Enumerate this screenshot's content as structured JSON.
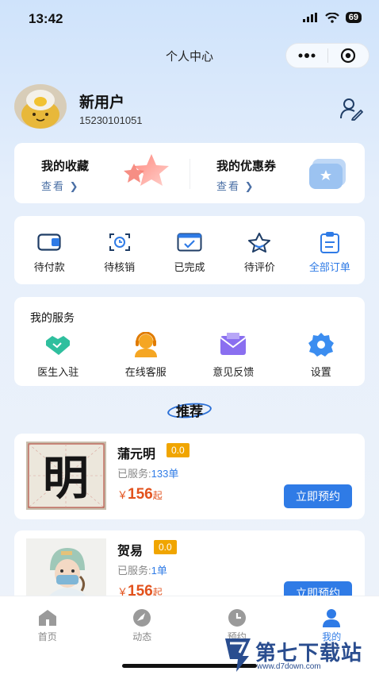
{
  "status_bar": {
    "time": "13:42",
    "battery": "69"
  },
  "nav": {
    "title": "个人中心"
  },
  "profile": {
    "name": "新用户",
    "phone": "15230101051"
  },
  "favorites": {
    "my_favorites": {
      "title": "我的收藏",
      "link": "查看"
    },
    "my_coupons": {
      "title": "我的优惠券",
      "link": "查看"
    }
  },
  "orders": [
    {
      "label": "待付款"
    },
    {
      "label": "待核销"
    },
    {
      "label": "已完成"
    },
    {
      "label": "待评价"
    },
    {
      "label": "全部订单"
    }
  ],
  "services": {
    "title": "我的服务",
    "items": [
      {
        "label": "医生入驻"
      },
      {
        "label": "在线客服"
      },
      {
        "label": "意见反馈"
      },
      {
        "label": "设置"
      }
    ]
  },
  "recommend": {
    "title": "推荐",
    "doctors": [
      {
        "name": "蒲元明",
        "rating": "0.0",
        "served_label": "已服务:",
        "served_count": "133单",
        "price_symbol": "￥",
        "price": "156",
        "price_suffix": "起",
        "button": "立即预约",
        "photo_char": "明"
      },
      {
        "name": "贺易",
        "rating": "0.0",
        "served_label": "已服务:",
        "served_count": "1单",
        "price_symbol": "￥",
        "price": "156",
        "price_suffix": "起",
        "button": "立即预约"
      }
    ]
  },
  "tabbar": [
    {
      "label": "首页",
      "active": false
    },
    {
      "label": "动态",
      "active": false
    },
    {
      "label": "预约",
      "active": false
    },
    {
      "label": "我的",
      "active": true
    }
  ],
  "watermark": {
    "text": "第七下载站",
    "url": "www.d7down.com"
  },
  "colors": {
    "accent": "#2f7be6",
    "price": "#e2521d",
    "badge": "#f0a500"
  }
}
